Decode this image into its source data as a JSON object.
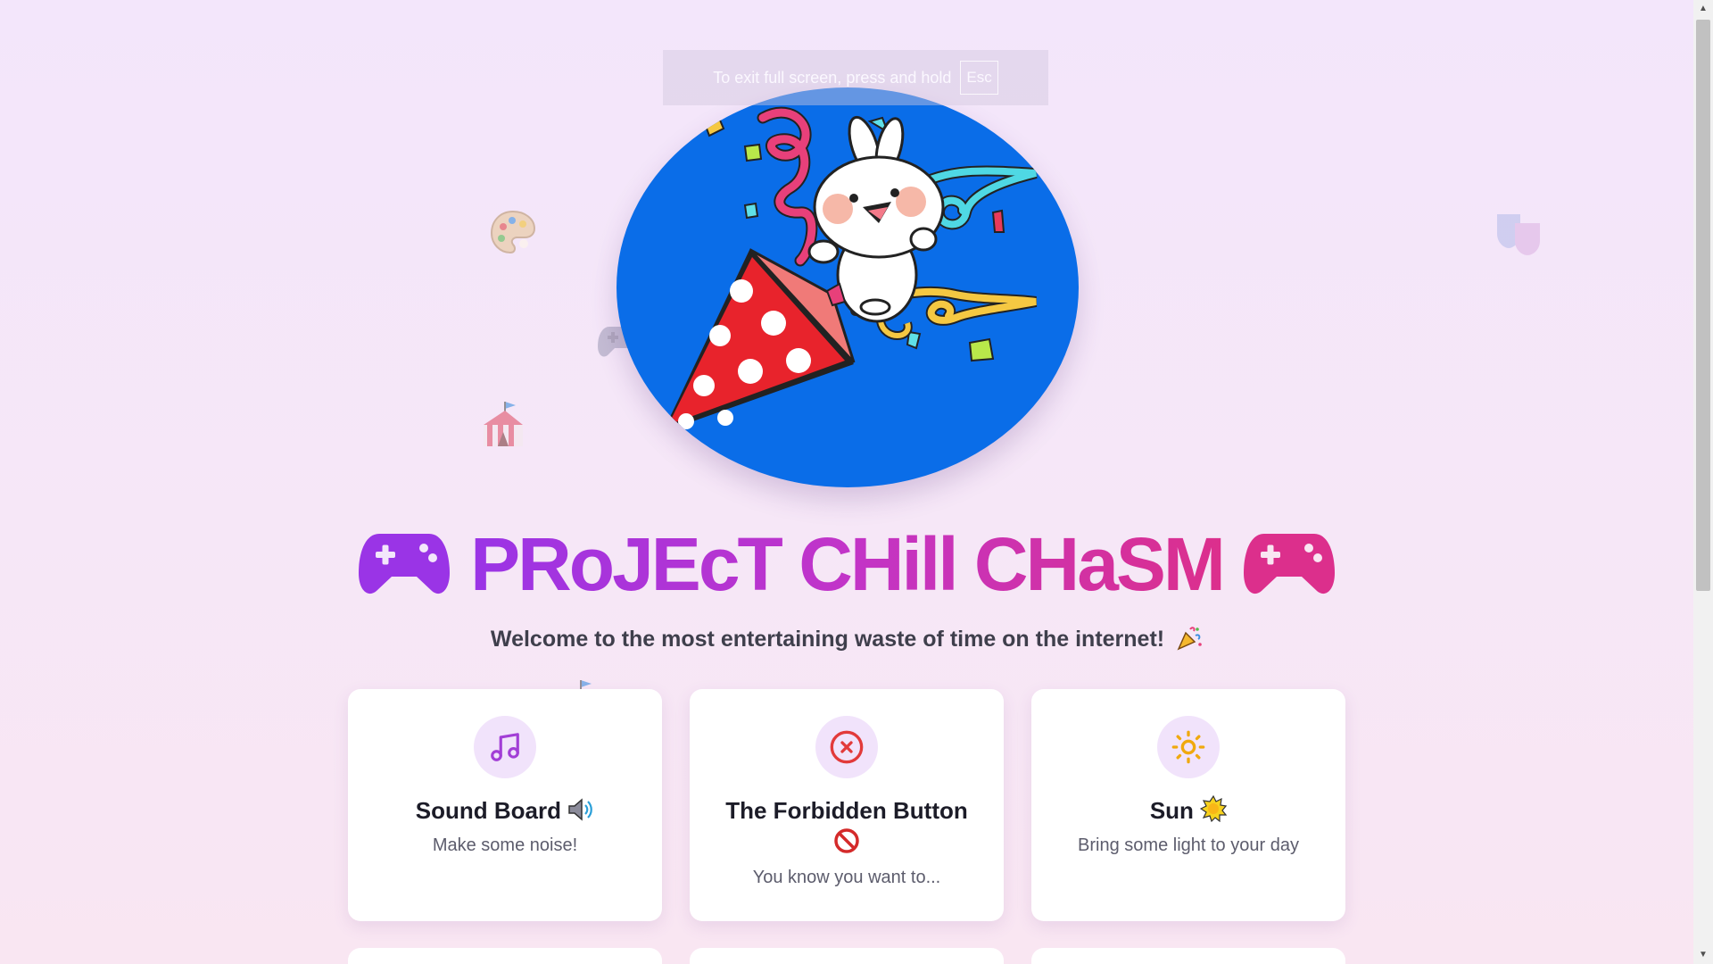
{
  "fullscreen_notice": {
    "text": "To exit full screen, press and hold",
    "key": "Esc"
  },
  "header": {
    "title": "PRoJEcT CHill CHaSM",
    "subtitle": "Welcome to the most entertaining waste of time on the internet!"
  },
  "cards": [
    {
      "title": "Sound Board",
      "description": "Make some noise!",
      "icon": "music-note-icon",
      "emoji": "speaker-emoji"
    },
    {
      "title": "The Forbidden Button",
      "description": "You know you want to...",
      "icon": "x-circle-icon",
      "emoji": "prohibited-emoji"
    },
    {
      "title": "Sun",
      "description": "Bring some light to your day",
      "icon": "sun-icon",
      "emoji": "sun-emoji"
    }
  ],
  "floating_emojis": [
    "palette-emoji",
    "game-controller-emoji",
    "circus-tent-emoji",
    "performing-arts-emoji"
  ],
  "colors": {
    "title_gradient_start": "#9a34e6",
    "title_gradient_end": "#dc2f8c",
    "hero_background": "#0a6de8",
    "icon_circle": "#f1e3fb"
  }
}
